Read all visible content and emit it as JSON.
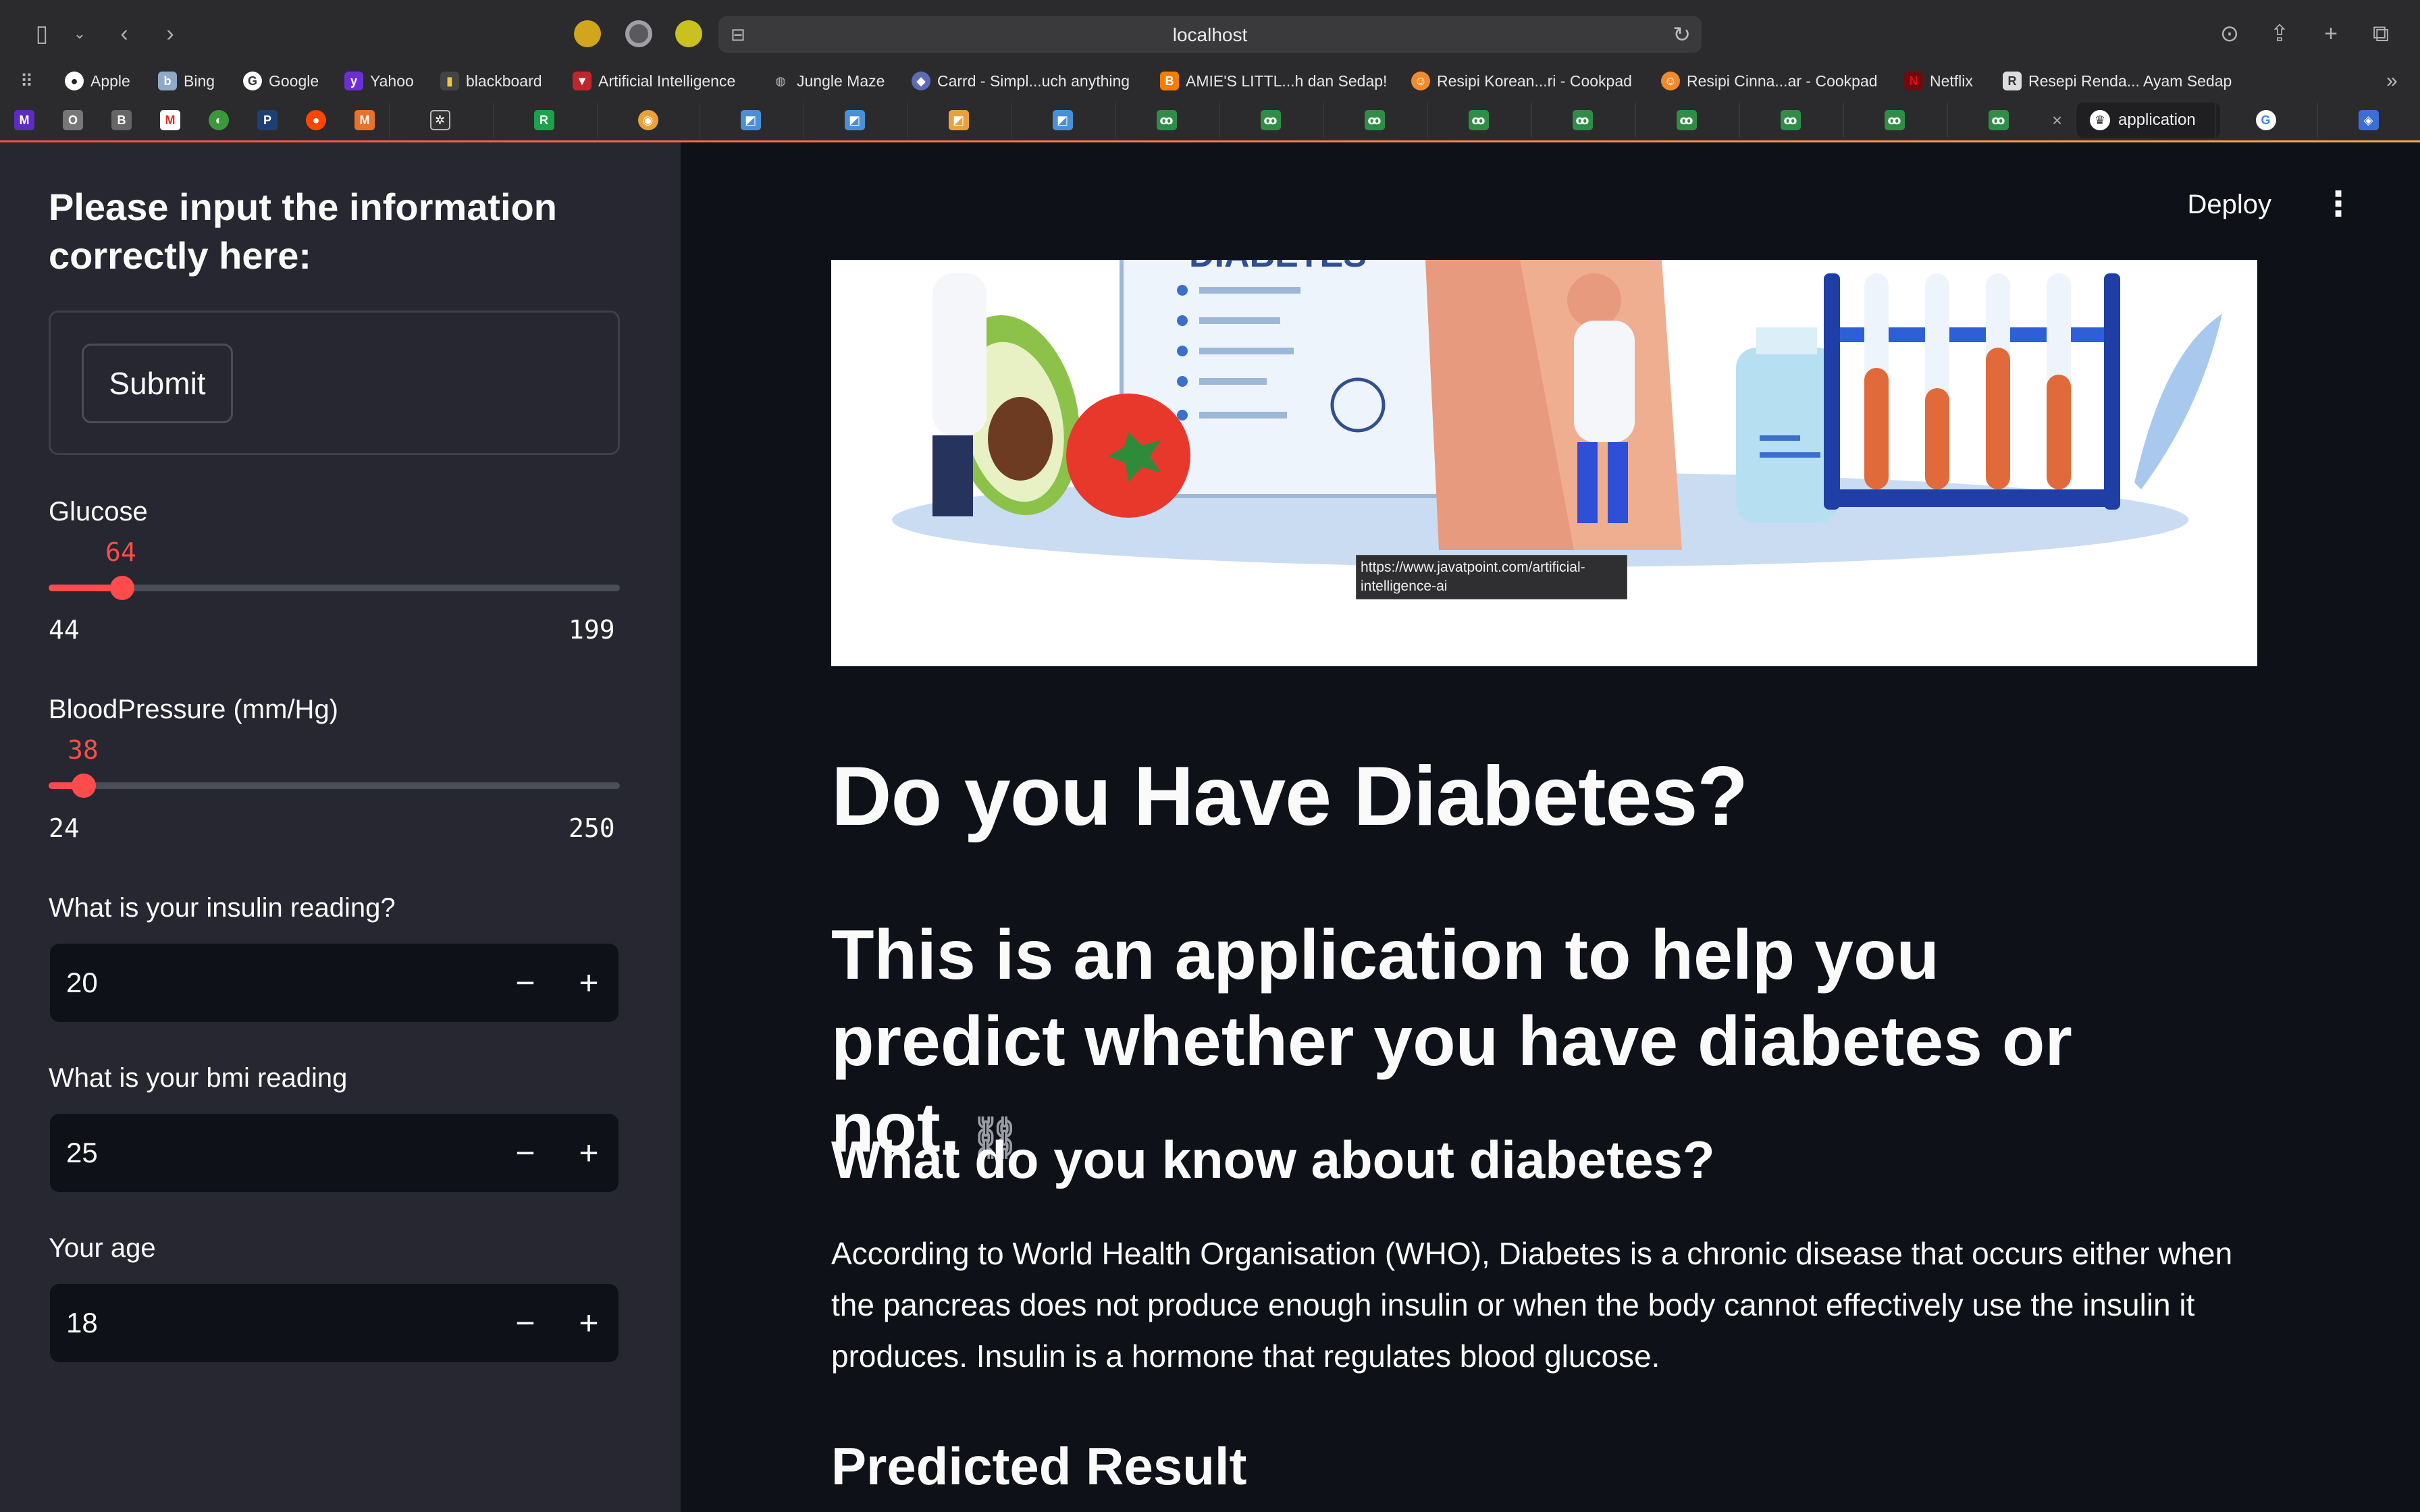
{
  "browser": {
    "url": "localhost",
    "bookmarks": [
      {
        "label": "Apple",
        "icon": "apple-icon"
      },
      {
        "label": "Bing",
        "icon": "bing-icon"
      },
      {
        "label": "Google",
        "icon": "google-icon"
      },
      {
        "label": "Yahoo",
        "icon": "yahoo-icon"
      },
      {
        "label": "blackboard",
        "icon": "blackboard-icon"
      },
      {
        "label": "Artificial Intelligence",
        "icon": "javatpoint-icon"
      },
      {
        "label": "Jungle Maze",
        "icon": "globe-icon"
      },
      {
        "label": "Carrd - Simpl...uch anything",
        "icon": "carrd-icon"
      },
      {
        "label": "AMIE'S LITTL...h dan Sedap!",
        "icon": "blogger-icon"
      },
      {
        "label": "Resipi Korean...ri - Cookpad",
        "icon": "cookpad-icon"
      },
      {
        "label": "Resipi Cinna...ar - Cookpad",
        "icon": "cookpad-icon"
      },
      {
        "label": "Netflix",
        "icon": "netflix-icon"
      },
      {
        "label": "Resepi Renda... Ayam Sedap",
        "icon": "resepi-icon"
      }
    ],
    "active_tab": "application"
  },
  "sidebar": {
    "title": "Please input the information correctly here:",
    "submit_label": "Submit",
    "glucose": {
      "label": "Glucose",
      "value": "64",
      "min": "44",
      "max": "199"
    },
    "blood_pressure": {
      "label": "BloodPressure (mm/Hg)",
      "value": "38",
      "min": "24",
      "max": "250"
    },
    "insulin": {
      "label": "What is your insulin reading?",
      "value": "20"
    },
    "bmi": {
      "label": "What is your bmi reading",
      "value": "25"
    },
    "age": {
      "label": "Your age",
      "value": "18"
    },
    "stepper": {
      "minus": "−",
      "plus": "+"
    }
  },
  "main": {
    "deploy_label": "Deploy",
    "menu_glyph": "⋮",
    "banner_text": "DIABETES",
    "tooltip": "https://www.javatpoint.com/artificial-intelligence-ai",
    "title": "Do you Have Diabetes?",
    "subtitle": "This is an application to help you predict whether you have diabetes or not.",
    "about_heading": "What do you know about diabetes?",
    "about_text": "According to World Health Organisation (WHO), Diabetes is a chronic disease that occurs either when the pancreas does not produce enough insulin or when the body cannot effectively use the insulin it produces. Insulin is a hormone that regulates blood glucose.",
    "result_heading": "Predicted Result"
  },
  "colors": {
    "accent": "#ff4b4b",
    "sidebar_bg": "#262730",
    "main_bg": "#0e1117"
  }
}
